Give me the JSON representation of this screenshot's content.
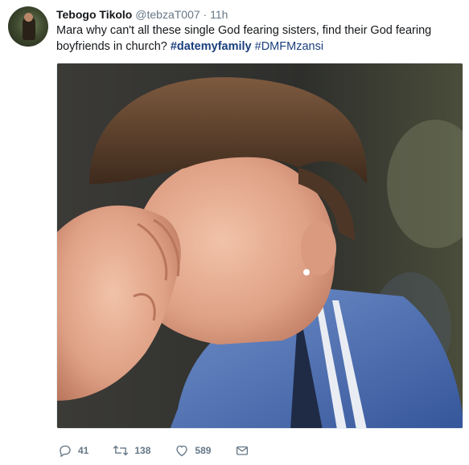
{
  "tweet": {
    "author_name": "Tebogo Tikolo",
    "author_handle": "@tebzaT007",
    "separator": "·",
    "timestamp": "11h",
    "text_plain": "Mara why can't all these single God fearing sisters, find their God fearing boyfriends in church?",
    "hashtags": [
      "#datemyfamily",
      "#DMFMzansi"
    ],
    "media_description": "photo of young man covering his face with hand"
  },
  "actions": {
    "reply": {
      "icon": "reply-icon",
      "count": "41"
    },
    "retweet": {
      "icon": "retweet-icon",
      "count": "138"
    },
    "like": {
      "icon": "heart-icon",
      "count": "589"
    },
    "message": {
      "icon": "envelope-icon"
    }
  },
  "colors": {
    "name": "#14171a",
    "meta": "#657786",
    "hashtag": "#1b3f7d",
    "border": "#e6ecf0"
  }
}
